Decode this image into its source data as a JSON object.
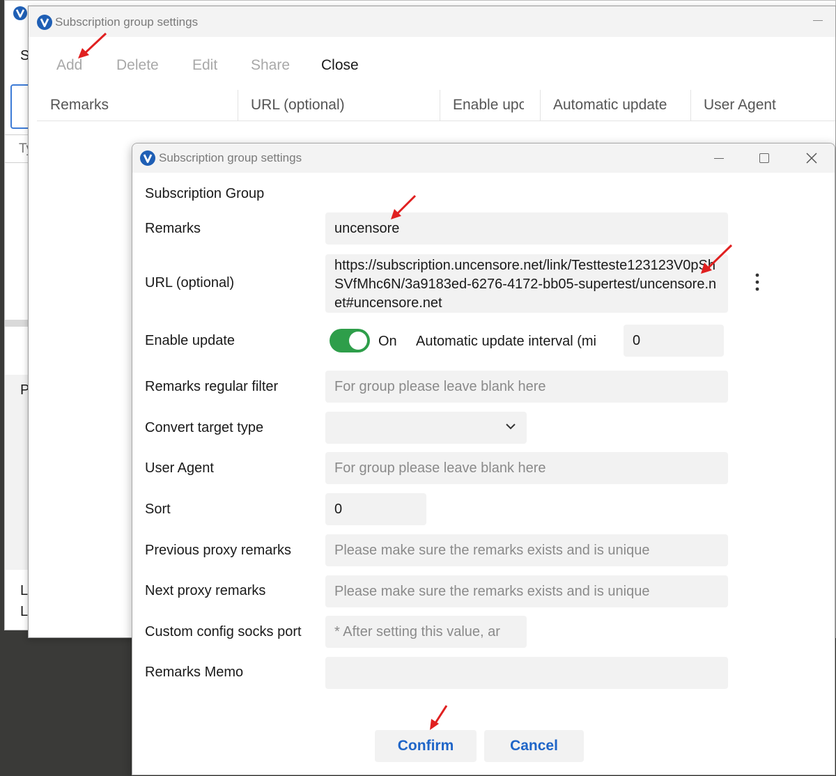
{
  "background_window": {
    "fragments": [
      "S",
      "Ty",
      "P",
      "L",
      "L"
    ]
  },
  "list_window": {
    "title": "Subscription group settings",
    "toolbar": {
      "add": "Add",
      "delete": "Delete",
      "edit": "Edit",
      "share": "Share",
      "close": "Close"
    },
    "columns": [
      "Remarks",
      "URL (optional)",
      "Enable upc",
      "Automatic update",
      "User Agent"
    ]
  },
  "dialog": {
    "title": "Subscription group settings",
    "group_heading": "Subscription Group",
    "remarks": {
      "label": "Remarks",
      "value": "uncensore"
    },
    "url": {
      "label": "URL (optional)",
      "value": "https://subscription.uncensore.net/link/Testteste123123V0pShSVfMhc6N/3a9183ed-6276-4172-bb05-supertest/uncensore.net#uncensore.net"
    },
    "enable_update": {
      "label": "Enable update",
      "state": "On",
      "enabled": true
    },
    "interval": {
      "label": "Automatic update interval (mi",
      "value": "0"
    },
    "remarks_filter": {
      "label": "Remarks regular filter",
      "placeholder": "For group please leave blank here"
    },
    "convert_target": {
      "label": "Convert target type",
      "value": ""
    },
    "user_agent": {
      "label": "User Agent",
      "placeholder": "For group please leave blank here"
    },
    "sort": {
      "label": "Sort",
      "value": "0"
    },
    "prev_proxy": {
      "label": "Previous proxy remarks",
      "placeholder": "Please make sure the remarks exists and is unique"
    },
    "next_proxy": {
      "label": "Next proxy remarks",
      "placeholder": "Please make sure the remarks exists and is unique"
    },
    "socks_port": {
      "label": "Custom config socks port",
      "placeholder": "* After setting this value, ar"
    },
    "memo": {
      "label": "Remarks Memo",
      "value": ""
    },
    "confirm": "Confirm",
    "cancel": "Cancel"
  },
  "colors": {
    "accent_blue": "#1f65c8",
    "toggle_green": "#2e9e4a",
    "annotation_red": "#e02020",
    "field_bg": "#f2f2f2"
  },
  "icons": [
    "v2ray-logo-icon",
    "minimize-icon",
    "maximize-icon",
    "close-icon",
    "more-vertical-icon",
    "chevron-down-icon",
    "red-arrow-annotation"
  ]
}
